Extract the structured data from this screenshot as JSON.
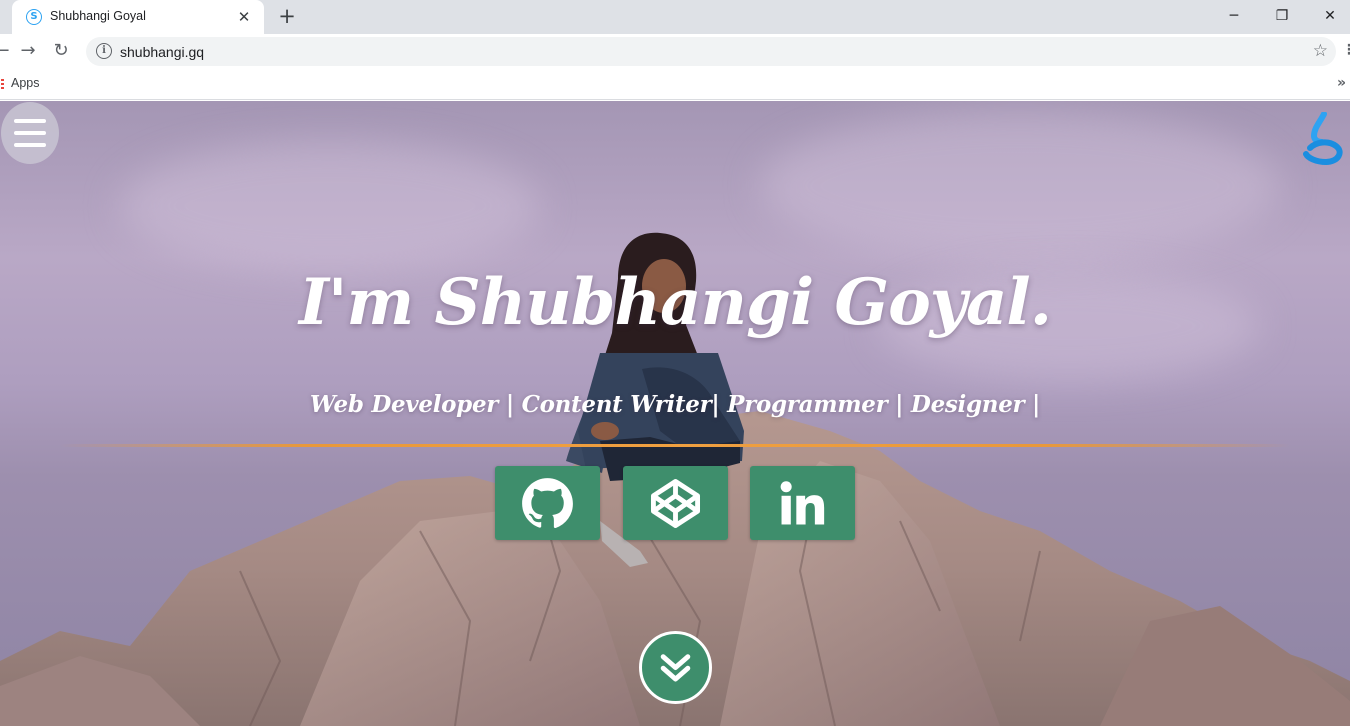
{
  "browser": {
    "tab": {
      "title": "Shubhangi Goyal",
      "favicon_icon": "site-logo-icon"
    },
    "url": "shubhangi.gq",
    "bookmarks": {
      "apps_label": "Apps"
    }
  },
  "hero": {
    "title": "I'm Shubhangi Goyal.",
    "subtitle": "Web Developer | Content Writer| Programmer | Designer |",
    "social": [
      {
        "name": "github",
        "icon": "github-icon"
      },
      {
        "name": "codepen",
        "icon": "codepen-icon"
      },
      {
        "name": "linkedin",
        "icon": "linkedin-icon"
      }
    ],
    "accent_color": "#3e8e6c",
    "divider_color": "#f0a040"
  }
}
